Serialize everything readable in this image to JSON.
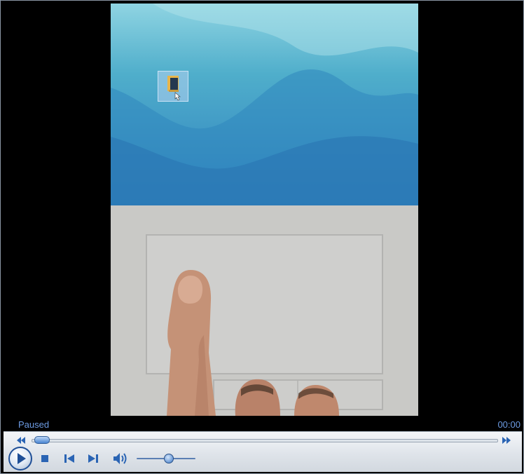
{
  "player": {
    "status": "Paused",
    "time": "00:00",
    "progress_fraction": 0.0,
    "volume_fraction": 0.55
  },
  "icons": {
    "rewind": "rewind-icon",
    "fast_forward": "fast-forward-icon",
    "play": "play-icon",
    "stop": "stop-icon",
    "previous": "previous-icon",
    "next": "next-icon",
    "volume": "speaker-icon"
  },
  "colors": {
    "status_text": "#6d9ce4",
    "accent": "#1f4f97",
    "video_background": "#000000",
    "desktop_sky_light": "#8fd4e2",
    "desktop_sky_dark": "#2f7fbf",
    "trackpad_surface": "#c9c9c6"
  }
}
